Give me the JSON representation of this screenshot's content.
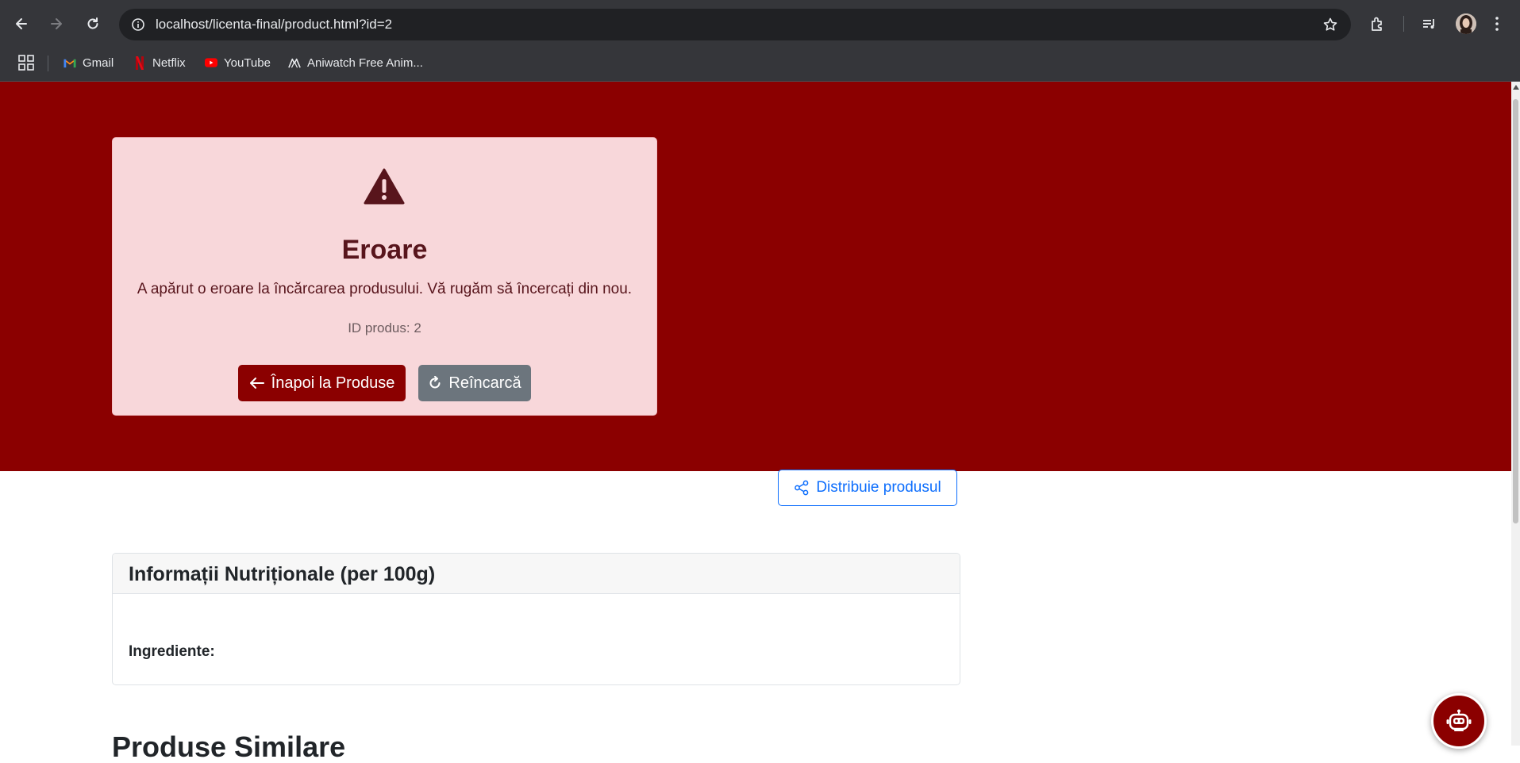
{
  "browser": {
    "url": "localhost/licenta-final/product.html?id=2",
    "bookmarks": [
      {
        "label": "Gmail",
        "icon": "gmail-icon"
      },
      {
        "label": "Netflix",
        "icon": "netflix-icon"
      },
      {
        "label": "YouTube",
        "icon": "youtube-icon"
      },
      {
        "label": "Aniwatch Free Anim...",
        "icon": "aniwatch-icon"
      }
    ]
  },
  "error": {
    "icon": "warning-triangle-icon",
    "title": "Eroare",
    "message": "A apărut o eroare la încărcarea produsului. Vă rugăm să încercați din nou.",
    "product_id": "ID produs: 2",
    "back_label": "Înapoi la Produse",
    "reload_label": "Reîncarcă"
  },
  "share": {
    "label": "Distribuie produsul"
  },
  "nutrition": {
    "title": "Informații Nutriționale (per 100g)",
    "ingredients_label": "Ingrediente:"
  },
  "similar": {
    "title": "Produse Similare"
  },
  "colors": {
    "brand": "#8b0000",
    "error_bg": "#f8d7da",
    "secondary": "#6c757d",
    "link": "#0d6efd"
  }
}
